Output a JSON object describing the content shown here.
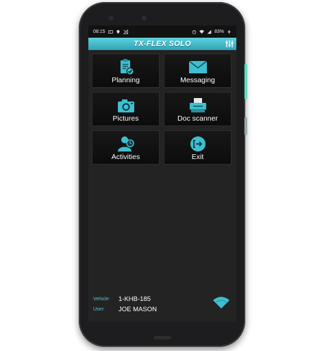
{
  "status": {
    "time": "08:15",
    "battery": "83%"
  },
  "app": {
    "title": "TX-FLEX SOLO"
  },
  "tiles": [
    {
      "label": "Planning",
      "icon": "clipboard-check-icon"
    },
    {
      "label": "Messaging",
      "icon": "envelope-icon"
    },
    {
      "label": "Pictures",
      "icon": "camera-icon"
    },
    {
      "label": "Doc scanner",
      "icon": "scanner-icon"
    },
    {
      "label": "Activities",
      "icon": "user-clock-icon"
    },
    {
      "label": "Exit",
      "icon": "exit-icon"
    }
  ],
  "footer": {
    "vehicle_label": "Vehicle:",
    "vehicle_value": "1-KHB-185",
    "user_label": "User:",
    "user_value": "JOE MASON"
  },
  "colors": {
    "accent": "#3fbfd0",
    "background": "#232323",
    "tile": "#111111"
  }
}
